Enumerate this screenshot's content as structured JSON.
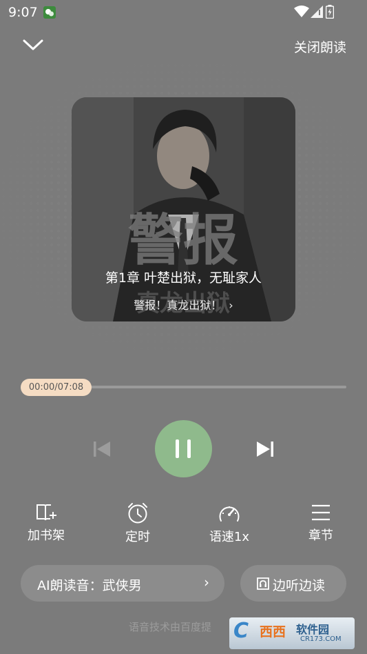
{
  "status_bar": {
    "time": "9:07",
    "icons": [
      "wechat-icon",
      "wifi-icon",
      "signal-icon",
      "battery-icon"
    ]
  },
  "header": {
    "collapse_icon": "chevron-down-icon",
    "close_reading": "关闭朗读"
  },
  "cover": {
    "title_art": "警报",
    "subtitle_art": "真龙出狱",
    "chapter": "第1章 叶楚出狱，无耻家人",
    "book_name": "警报！真龙出狱！",
    "book_chevron": "›"
  },
  "progress": {
    "time": "00:00/07:08",
    "fraction": 0.0
  },
  "controls": {
    "prev_icon": "skip-previous-icon",
    "play_state_icon": "pause-icon",
    "next_icon": "skip-next-icon"
  },
  "tools": [
    {
      "label": "加书架",
      "icon": "add-bookshelf-icon"
    },
    {
      "label": "定时",
      "icon": "alarm-clock-icon"
    },
    {
      "label": "语速1x",
      "icon": "speedometer-icon"
    },
    {
      "label": "章节",
      "icon": "menu-list-icon"
    }
  ],
  "voice": {
    "label": "AI朗读音：武侠男",
    "chevron": "›"
  },
  "listen_read": {
    "label": "边听边读",
    "icon": "headphones-book-icon"
  },
  "footer": {
    "note": "语音技术由百度提"
  },
  "watermark": {
    "logo": "C",
    "brand": "西西",
    "sub": "软件园",
    "url": "CR173.COM"
  },
  "colors": {
    "background": "#7b7b7b",
    "play_button": "#8fba8c",
    "progress_pill": "#f5dcc3",
    "pill_bg": "#8c8c8c"
  }
}
